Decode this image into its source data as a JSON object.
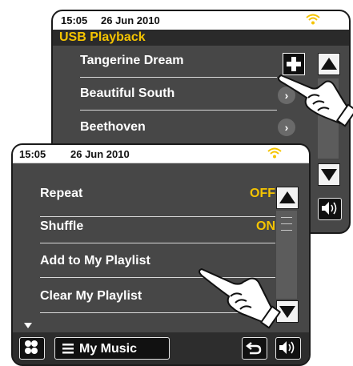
{
  "back_screen": {
    "status": {
      "time": "15:05",
      "date": "26 Jun 2010"
    },
    "title": "USB Playback",
    "items": [
      {
        "label": "Tangerine Dream"
      },
      {
        "label": "Beautiful South"
      },
      {
        "label": "Beethoven"
      }
    ],
    "icons": {
      "add": "plus-icon",
      "more": "chevron-right-icon",
      "up": "arrow-up-icon",
      "down": "arrow-down-icon",
      "volume": "speaker-icon"
    }
  },
  "front_screen": {
    "status": {
      "time": "15:05",
      "date": "26 Jun 2010"
    },
    "options": [
      {
        "label": "Repeat",
        "value": "OFF"
      },
      {
        "label": "Shuffle",
        "value": "ON"
      },
      {
        "label": "Add to My Playlist",
        "value": ""
      },
      {
        "label": "Clear My Playlist",
        "value": ""
      }
    ],
    "bottom_bar": {
      "menu_label": "My Music",
      "icons": [
        "grid-menu-icon",
        "list-icon",
        "back-arrow-icon",
        "speaker-icon"
      ]
    }
  },
  "colors": {
    "accent": "#f5c400",
    "screen_bg": "#474747",
    "wifi": "#f5c400"
  }
}
